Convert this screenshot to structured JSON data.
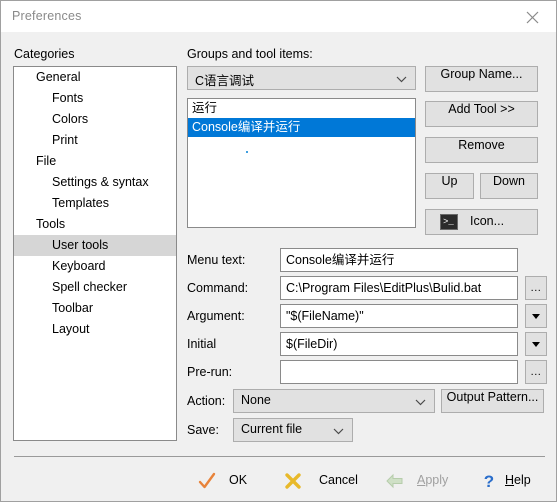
{
  "window": {
    "title": "Preferences",
    "close_icon": "close-icon"
  },
  "sidebar": {
    "label": "Categories",
    "items": [
      {
        "label": "General",
        "level": 0,
        "selected": false
      },
      {
        "label": "Fonts",
        "level": 1,
        "selected": false
      },
      {
        "label": "Colors",
        "level": 1,
        "selected": false
      },
      {
        "label": "Print",
        "level": 1,
        "selected": false
      },
      {
        "label": "File",
        "level": 0,
        "selected": false
      },
      {
        "label": "Settings & syntax",
        "level": 1,
        "selected": false
      },
      {
        "label": "Templates",
        "level": 1,
        "selected": false
      },
      {
        "label": "Tools",
        "level": 0,
        "selected": false
      },
      {
        "label": "User tools",
        "level": 1,
        "selected": true
      },
      {
        "label": "Keyboard",
        "level": 1,
        "selected": false
      },
      {
        "label": "Spell checker",
        "level": 1,
        "selected": false
      },
      {
        "label": "Toolbar",
        "level": 1,
        "selected": false
      },
      {
        "label": "Layout",
        "level": 1,
        "selected": false
      }
    ]
  },
  "groups": {
    "label": "Groups and tool items:",
    "selected_group": "C语言调试",
    "items": [
      {
        "label": "运行",
        "selected": false
      },
      {
        "label": "Console编译并运行",
        "selected": true
      }
    ],
    "buttons": {
      "group_name": "Group Name...",
      "add_tool": "Add Tool >>",
      "remove": "Remove",
      "up": "Up",
      "down": "Down",
      "icon": "Icon...",
      "icon_glyph": ">_"
    }
  },
  "form": {
    "menu_text": {
      "label": "Menu text:",
      "value": "Console编译并运行"
    },
    "command": {
      "label": "Command:",
      "value": "C:\\Program Files\\EditPlus\\Bulid.bat",
      "browse": "..."
    },
    "argument": {
      "label": "Argument:",
      "value": "\"$(FileName)\"",
      "dropdown": "▼"
    },
    "initial": {
      "label": "Initial",
      "value": "$(FileDir)",
      "dropdown": "▼"
    },
    "prerun": {
      "label": "Pre-run:",
      "value": "",
      "browse": "..."
    },
    "action": {
      "label": "Action:",
      "value": "None",
      "output_pattern": "Output Pattern..."
    },
    "save": {
      "label": "Save:",
      "value": "Current file"
    }
  },
  "footer": {
    "ok": "OK",
    "cancel": "Cancel",
    "apply": "Apply",
    "help": "Help",
    "apply_enabled": false
  },
  "colors": {
    "selection_blue": "#0078d7",
    "tree_selection_gray": "#d6d6d6",
    "window_bg": "#f0f0f0",
    "control_bg": "#e1e1e1",
    "ok_check": "#e8833a",
    "cancel_x": "#e8b92a",
    "apply_arrow": "#c8dcc0",
    "help_blue": "#2a6ecb"
  }
}
